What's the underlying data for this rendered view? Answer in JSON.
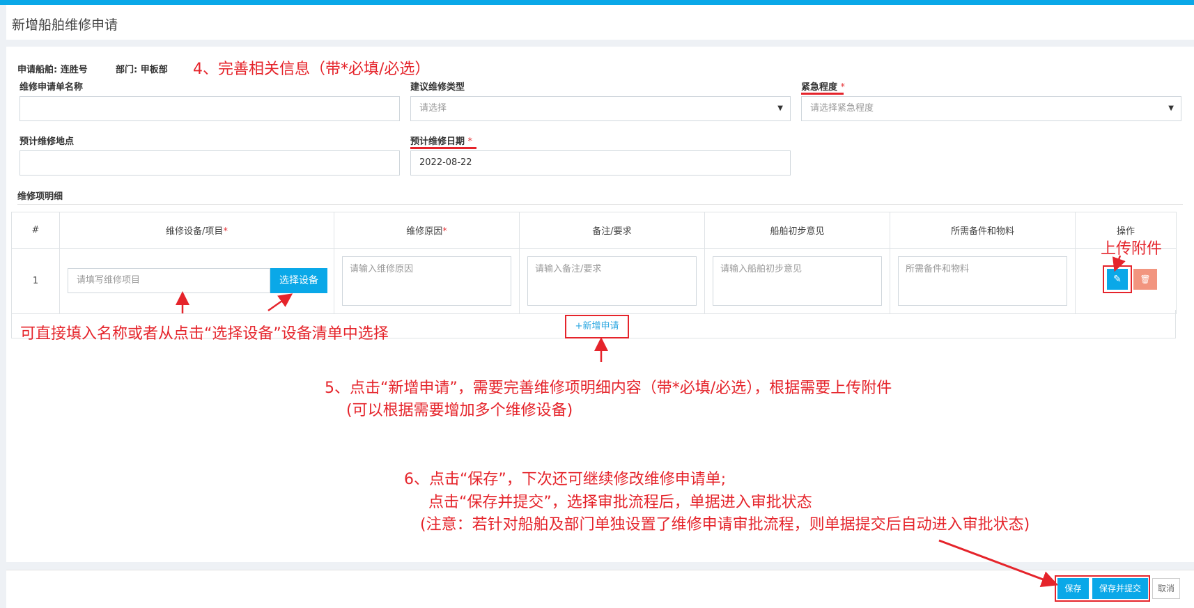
{
  "page": {
    "title": "新增船舶维修申请"
  },
  "info": {
    "ship_label": "申请船舶: 连胜号",
    "dept_label": "部门: 甲板部"
  },
  "form": {
    "name_label": "维修申请单名称",
    "name_value": "",
    "type_label": "建议维修类型",
    "type_value": "请选择",
    "urgency_label": "紧急程度",
    "urgency_placeholder": "请选择紧急程度",
    "location_label": "预计维修地点",
    "location_value": "",
    "date_label": "预计维修日期",
    "date_value": "2022-08-22",
    "required_mark": "*"
  },
  "details": {
    "section_label": "维修项明细",
    "columns": [
      "#",
      "维修设备/项目",
      "维修原因",
      "备注/要求",
      "船舶初步意见",
      "所需备件和物料",
      "操作"
    ],
    "required_mark": "*",
    "rows": [
      {
        "index": "1",
        "equipment_placeholder": "请填写维修项目",
        "choose_button": "选择设备",
        "reason_placeholder": "请输入维修原因",
        "remark_placeholder": "请输入备注/要求",
        "opinion_placeholder": "请输入船舶初步意见",
        "parts_placeholder": "所需备件和物料"
      }
    ],
    "add_button": "+新增申请"
  },
  "icons": {
    "attach": "paperclip-icon",
    "delete": "trash-icon"
  },
  "footer": {
    "save": "保存",
    "save_submit": "保存并提交",
    "cancel": "取消"
  },
  "annotations": {
    "step4": "4、完善相关信息（带*必填/必选）",
    "upload": "上传附件",
    "equip_hint": "可直接填入名称或者从点击“选择设备”设备清单中选择",
    "step5_line1": "5、点击“新增申请”，需要完善维修项明细内容（带*必填/必选），根据需要上传附件",
    "step5_line2": "(可以根据需要增加多个维修设备)",
    "step6_line1": "6、点击“保存”，下次还可继续修改维修申请单;",
    "step6_line2": "点击“保存并提交”，选择审批流程后，单据进入审批状态",
    "step6_line3": "(注意：若针对船舶及部门单独设置了维修申请审批流程，则单据提交后自动进入审批状态)"
  },
  "colors": {
    "accent": "#0aa8e8",
    "annotation_red": "#e5242b",
    "delete_button": "#f2957f"
  }
}
